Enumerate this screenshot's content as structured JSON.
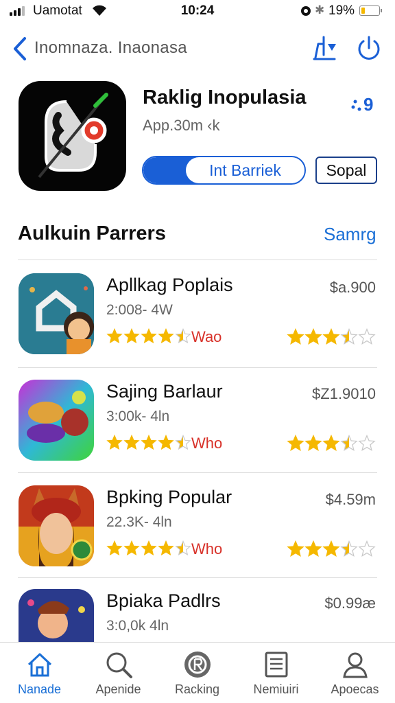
{
  "status_bar": {
    "carrier": "Uamotat",
    "time": "10:24",
    "battery_percent": "19%",
    "battery_level": 0.19
  },
  "nav": {
    "title": "Inomnaza. Inaonasa",
    "back_icon": "chevron-left-icon",
    "share_icon": "share-icon",
    "power_icon": "power-icon"
  },
  "app": {
    "title": "Raklig Inopulasia",
    "subtitle": "App.30m ‹k",
    "rank": "9",
    "get_label": "Int Barriek",
    "secondary_label": "Sopal"
  },
  "section": {
    "title": "Aulkuin Parrers",
    "link": "Samrg"
  },
  "apps": [
    {
      "name": "Apllkag Poplais",
      "downloads": "2:008- 4W",
      "tag": "Wao",
      "price": "$a.900",
      "rating": 4.5,
      "rating_right": 3.5
    },
    {
      "name": "Sajing Barlaur",
      "downloads": "3:00k- 4ln",
      "tag": "Who",
      "price": "$Z1.9010",
      "rating": 4.5,
      "rating_right": 3.5
    },
    {
      "name": "Bpking Popular",
      "downloads": "22.3K- 4ln",
      "tag": "Who",
      "price": "$4.59m",
      "rating": 4.5,
      "rating_right": 3.5
    },
    {
      "name": "Bpiaka Padlrs",
      "downloads": "3:0,0k 4ln",
      "tag": "",
      "price": "$0.99æ",
      "rating": 0,
      "rating_right": 0
    }
  ],
  "tabs": [
    {
      "label": "Nanade",
      "icon": "home-icon",
      "active": true
    },
    {
      "label": "Apenide",
      "icon": "search-icon",
      "active": false
    },
    {
      "label": "Racking",
      "icon": "ranking-icon",
      "active": false
    },
    {
      "label": "Nemiuiri",
      "icon": "list-icon",
      "active": false
    },
    {
      "label": "Apoecas",
      "icon": "profile-icon",
      "active": false
    }
  ],
  "colors": {
    "accent": "#1a5fd6",
    "star": "#f5b800",
    "tag": "#d8322a"
  }
}
